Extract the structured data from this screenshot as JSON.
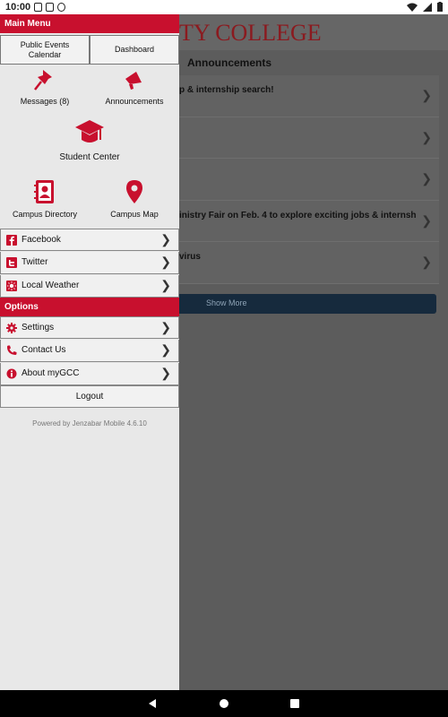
{
  "status_bar": {
    "time": "10:00"
  },
  "background": {
    "college_title": "TY COLLEGE",
    "announcements_header": "Announcements",
    "announcements": [
      "p & internship search!",
      "",
      "",
      "inistry Fair on Feb. 4 to explore exciting jobs & internship…",
      "virus"
    ],
    "show_more": "Show More"
  },
  "drawer": {
    "main_menu_label": "Main Menu",
    "public_events": "Public Events\nCalendar",
    "dashboard": "Dashboard",
    "messages": "Messages (8)",
    "announcements": "Announcements",
    "student_center": "Student Center",
    "campus_directory": "Campus Directory",
    "campus_map": "Campus Map",
    "links": [
      {
        "label": "Facebook",
        "icon": "facebook-icon"
      },
      {
        "label": "Twitter",
        "icon": "twitter-icon"
      },
      {
        "label": "Local Weather",
        "icon": "weather-icon"
      }
    ],
    "options_label": "Options",
    "options": [
      {
        "label": "Settings",
        "icon": "gear-icon"
      },
      {
        "label": "Contact Us",
        "icon": "phone-icon"
      },
      {
        "label": "About myGCC",
        "icon": "info-icon"
      }
    ],
    "logout": "Logout",
    "powered_by": "Powered by Jenzabar Mobile 4.6.10"
  },
  "colors": {
    "accent": "#c8102e",
    "drawer_bg": "#e8e8e8",
    "show_more_bg": "#162a3d"
  }
}
